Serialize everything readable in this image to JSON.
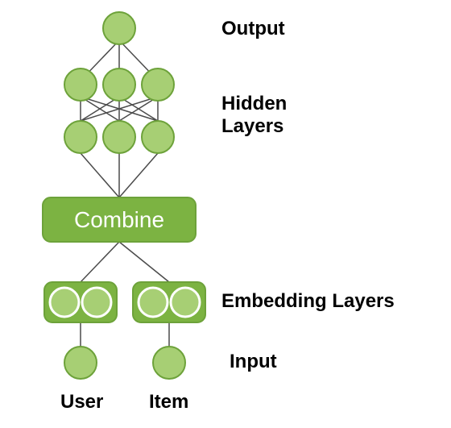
{
  "labels": {
    "output": "Output",
    "hidden": "Hidden\nLayers",
    "combine": "Combine",
    "embedding": "Embedding Layers",
    "input": "Input",
    "user": "User",
    "item": "Item"
  },
  "style": {
    "nodeFill": "#a7cf74",
    "nodeStroke": "#6da23a",
    "boxFill": "#7cb342",
    "boxStroke": "#6da23a",
    "lineStroke": "#4b4b4b"
  }
}
